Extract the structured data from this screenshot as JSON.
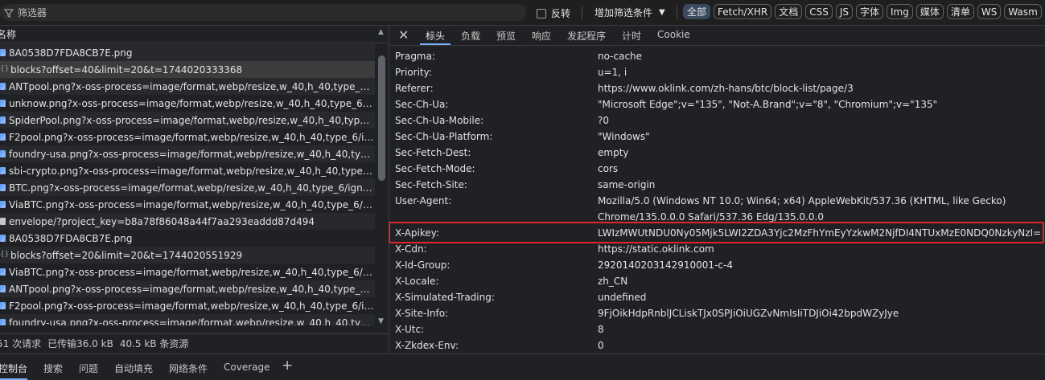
{
  "toolbar": {
    "filter_placeholder": "筛选器",
    "invert_label": "反转",
    "more_filters_label": "增加筛选条件",
    "chips": [
      "全部",
      "Fetch/XHR",
      "文档",
      "CSS",
      "JS",
      "字体",
      "Img",
      "媒体",
      "清单",
      "WS",
      "Wasm"
    ]
  },
  "request_list": {
    "header_label": "名称",
    "items": [
      {
        "name": "8A0538D7FDA8CB7E.png",
        "kind": "img"
      },
      {
        "name": "blocks?offset=40&limit=20&t=1744020333368",
        "kind": "xhr"
      },
      {
        "name": "ANTpool.png?x-oss-process=image/format,webp/resize,w_40,h_40,type_6/ig...",
        "kind": "img"
      },
      {
        "name": "unknow.png?x-oss-process=image/format,webp/resize,w_40,h_40,type_6/ign...",
        "kind": "img"
      },
      {
        "name": "SpiderPool.png?x-oss-process=image/format,webp/resize,w_40,h_40,type_6/...",
        "kind": "img"
      },
      {
        "name": "F2pool.png?x-oss-process=image/format,webp/resize,w_40,h_40,type_6/igno...",
        "kind": "img"
      },
      {
        "name": "foundry-usa.png?x-oss-process=image/format,webp/resize,w_40,h_40,type_...",
        "kind": "img"
      },
      {
        "name": "sbi-crypto.png?x-oss-process=image/format,webp/resize,w_40,h_40,type_6/i...",
        "kind": "img"
      },
      {
        "name": "BTC.png?x-oss-process=image/format,webp/resize,w_40,h_40,type_6/ignore-...",
        "kind": "img"
      },
      {
        "name": "ViaBTC.png?x-oss-process=image/format,webp/resize,w_40,h_40,type_6/igno...",
        "kind": "img"
      },
      {
        "name": "envelope/?project_key=b8a78f86048a44f7aa293eaddd87d494",
        "kind": "doc"
      },
      {
        "name": "8A0538D7FDA8CB7E.png",
        "kind": "img"
      },
      {
        "name": "blocks?offset=20&limit=20&t=1744020551929",
        "kind": "xhr"
      },
      {
        "name": "ViaBTC.png?x-oss-process=image/format,webp/resize,w_40,h_40,type_6/igno...",
        "kind": "img"
      },
      {
        "name": "ANTpool.png?x-oss-process=image/format,webp/resize,w_40,h_40,type_6/ig...",
        "kind": "img"
      },
      {
        "name": "F2pool.png?x-oss-process=image/format,webp/resize,w_40,h_40,type_6/igno...",
        "kind": "img"
      },
      {
        "name": "foundry-usa.png?x-oss-process=image/format,webp/resize,w_40,h_40,type_...",
        "kind": "img"
      }
    ],
    "status": {
      "requests": "51 次请求",
      "transferred": "已传输36.0 kB",
      "resources": "40.5 kB 条资源"
    }
  },
  "detail_tabs": [
    "标头",
    "负载",
    "预览",
    "响应",
    "发起程序",
    "计时",
    "Cookie"
  ],
  "headers": [
    {
      "name": "Pragma:",
      "value": "no-cache"
    },
    {
      "name": "Priority:",
      "value": "u=1, i"
    },
    {
      "name": "Referer:",
      "value": "https://www.oklink.com/zh-hans/btc/block-list/page/3"
    },
    {
      "name": "Sec-Ch-Ua:",
      "value": "\"Microsoft Edge\";v=\"135\", \"Not-A.Brand\";v=\"8\", \"Chromium\";v=\"135\""
    },
    {
      "name": "Sec-Ch-Ua-Mobile:",
      "value": "?0"
    },
    {
      "name": "Sec-Ch-Ua-Platform:",
      "value": "\"Windows\""
    },
    {
      "name": "Sec-Fetch-Dest:",
      "value": "empty"
    },
    {
      "name": "Sec-Fetch-Mode:",
      "value": "cors"
    },
    {
      "name": "Sec-Fetch-Site:",
      "value": "same-origin"
    },
    {
      "name": "User-Agent:",
      "value": "Mozilla/5.0 (Windows NT 10.0; Win64; x64) AppleWebKit/537.36 (KHTML, like Gecko)",
      "value2": "Chrome/135.0.0.0 Safari/537.36 Edg/135.0.0.0"
    },
    {
      "name": "X-Apikey:",
      "value": "LWIzMWUtNDU0Ny05Mjk5LWI2ZDA3Yjc2MzFhYmEyYzkwM2NjfDI4NTUxMzE0NDQ0NzkyNzI="
    },
    {
      "name": "X-Cdn:",
      "value": "https://static.oklink.com"
    },
    {
      "name": "X-Id-Group:",
      "value": "2920140203142910001-c-4"
    },
    {
      "name": "X-Locale:",
      "value": "zh_CN"
    },
    {
      "name": "X-Simulated-Trading:",
      "value": "undefined"
    },
    {
      "name": "X-Site-Info:",
      "value": "9FjOikHdpRnblJCLiskTJx0SPJiOiUGZvNmIsIiTDJiOi42bpdWZyJye"
    },
    {
      "name": "X-Utc:",
      "value": "8"
    },
    {
      "name": "X-Zkdex-Env:",
      "value": "0"
    }
  ],
  "drawer_tabs": [
    "控制台",
    "搜索",
    "问题",
    "自动填充",
    "网络条件",
    "Coverage",
    "+"
  ],
  "colors": {
    "highlight_border": "#e0252b",
    "active_tab_underline": "#7cacf8"
  }
}
